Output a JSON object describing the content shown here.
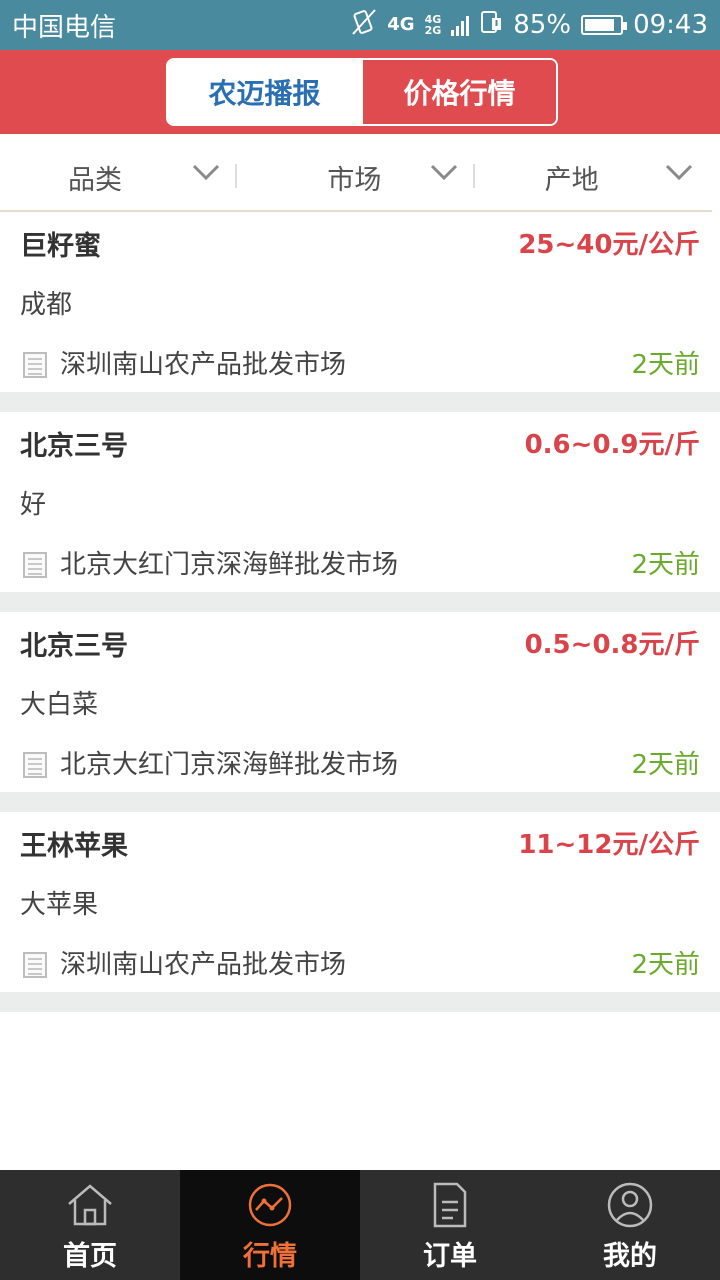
{
  "status_bar": {
    "carrier": "中国电信",
    "network": "4G",
    "network_small_top": "4G",
    "network_small_bottom": "2G",
    "battery": "85%",
    "battery_level": 0.85,
    "time": "09:43"
  },
  "header": {
    "tabs": [
      {
        "label": "农迈播报",
        "active": true
      },
      {
        "label": "价格行情",
        "active": false
      }
    ]
  },
  "filters": [
    {
      "label": "品类"
    },
    {
      "label": "市场"
    },
    {
      "label": "产地"
    }
  ],
  "listings": [
    {
      "title": "巨籽蜜",
      "price": "25~40元/公斤",
      "origin": "成都",
      "market": "深圳南山农产品批发市场",
      "time": "2天前"
    },
    {
      "title": "北京三号",
      "price": "0.6~0.9元/斤",
      "origin": "好",
      "market": "北京大红门京深海鲜批发市场",
      "time": "2天前"
    },
    {
      "title": "北京三号",
      "price": "0.5~0.8元/斤",
      "origin": "大白菜",
      "market": "北京大红门京深海鲜批发市场",
      "time": "2天前"
    },
    {
      "title": "王林苹果",
      "price": "11~12元/公斤",
      "origin": "大苹果",
      "market": "深圳南山农产品批发市场",
      "time": "2天前"
    }
  ],
  "tabbar": {
    "items": [
      {
        "label": "首页",
        "icon": "home-icon",
        "active": false
      },
      {
        "label": "行情",
        "icon": "trend-chart-icon",
        "active": true
      },
      {
        "label": "订单",
        "icon": "document-icon",
        "active": false
      },
      {
        "label": "我的",
        "icon": "user-profile-icon",
        "active": false
      }
    ]
  },
  "colors": {
    "status_bar": "#4a8a9e",
    "header_red": "#e04b4f",
    "active_tab_text": "#2a6fb3",
    "price_red": "#d9434a",
    "time_green": "#6aaa2c",
    "tabbar_bg": "#2e2e2e",
    "tabbar_active": "#f0703a"
  }
}
